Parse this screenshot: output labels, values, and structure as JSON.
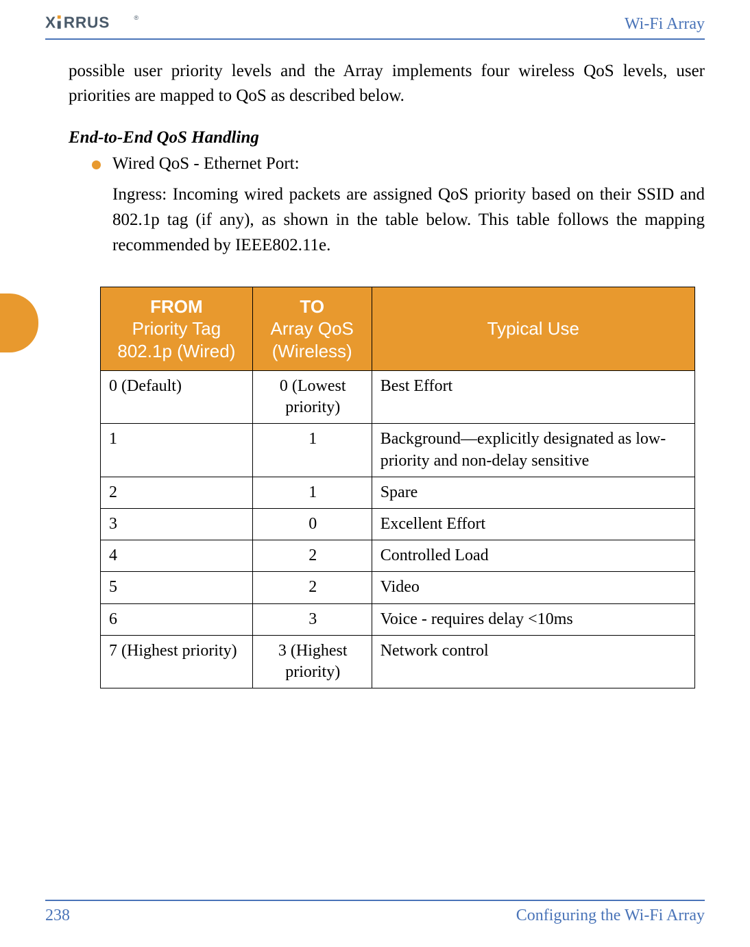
{
  "header": {
    "logo_text": "XIRRUS",
    "doc_title": "Wi-Fi Array"
  },
  "body": {
    "intro": "possible user priority levels and the Array implements four wireless QoS levels, user priorities are mapped to QoS as described below.",
    "subheading": "End-to-End QoS Handling",
    "bullet_title": "Wired QoS - Ethernet Port:",
    "bullet_body": "Ingress: Incoming wired packets are assigned QoS priority based on their SSID and 802.1p tag (if any), as shown in the table below. This table follows the mapping recommended by IEEE802.11e."
  },
  "table": {
    "headers": {
      "from_bold": "FROM",
      "from_sub": "Priority Tag 802.1p (Wired)",
      "to_bold": "TO",
      "to_sub": "Array QoS (Wireless)",
      "use": "Typical Use"
    },
    "rows": [
      {
        "from": "0 (Default)",
        "to": "0 (Lowest priority)",
        "use": "Best Effort"
      },
      {
        "from": "1",
        "to": "1",
        "use": "Background—explicitly designated as low-priority and non-delay sensitive"
      },
      {
        "from": "2",
        "to": "1",
        "use": "Spare"
      },
      {
        "from": "3",
        "to": "0",
        "use": "Excellent Effort"
      },
      {
        "from": "4",
        "to": "2",
        "use": "Controlled Load"
      },
      {
        "from": "5",
        "to": "2",
        "use": "Video"
      },
      {
        "from": "6",
        "to": "3",
        "use": "Voice - requires delay <10ms"
      },
      {
        "from": "7 (Highest priority)",
        "to": "3 (Highest priority)",
        "use": "Network control"
      }
    ]
  },
  "footer": {
    "page_number": "238",
    "section": "Configuring the Wi-Fi Array"
  },
  "colors": {
    "accent_orange": "#e8992e",
    "accent_blue": "#4a74b8",
    "logo_gray": "#4a5a6a"
  }
}
